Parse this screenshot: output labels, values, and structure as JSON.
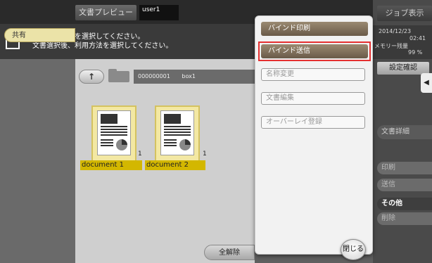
{
  "header": {
    "title_button": "文書プレビュー",
    "user": "user1"
  },
  "message": {
    "line1": "利用する文書を選択してください。",
    "line2": "文書選択後、利用方法を選択してください。"
  },
  "sidebar": {
    "shared_tab": "共有"
  },
  "path": {
    "box_number": "000000001",
    "box_name": "box1",
    "up_arrow": "↑"
  },
  "documents": [
    {
      "name": "document 1",
      "count": "1"
    },
    {
      "name": "document 2",
      "count": "1"
    }
  ],
  "footer": {
    "clear_all": "全解除"
  },
  "popup": {
    "items": [
      {
        "label": "バインド印刷",
        "enabled": true
      },
      {
        "label": "バインド送信",
        "enabled": true,
        "highlighted": true
      },
      {
        "label": "名称変更",
        "enabled": false
      },
      {
        "label": "文書編集",
        "enabled": false
      },
      {
        "label": "オーバーレイ登録",
        "enabled": false
      }
    ],
    "close": "閉じる"
  },
  "right_panel": {
    "job_button": "ジョブ表示",
    "date": "2014/12/23",
    "time": "02:41",
    "memory_label": "メモリー残量",
    "memory_value": "99 %",
    "settings_button": "設定確認",
    "side_tab_icon": "◀",
    "detail_button": "文書詳細",
    "tabs": [
      {
        "label": "印刷",
        "active": false
      },
      {
        "label": "送信",
        "active": false
      },
      {
        "label": "その他",
        "active": true
      },
      {
        "label": "削除",
        "active": false
      }
    ]
  },
  "colors": {
    "highlight": "#e53030",
    "doc_label": "#d3b700",
    "menu_dark": "#7a6a55"
  }
}
